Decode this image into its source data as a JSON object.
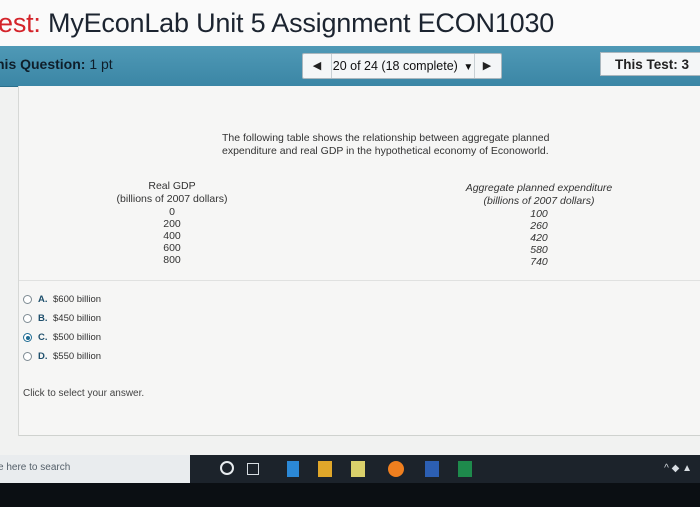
{
  "header": {
    "title_accent": "est:",
    "title_rest": " MyEconLab Unit 5 Assignment ECON1030"
  },
  "question_bar": {
    "points_label": "nis Question:",
    "points_value": " 1 pt",
    "prev_icon": "triangle-left-icon",
    "next_icon": "triangle-right-icon",
    "progress": "20 of 24 (18 complete)",
    "this_test": "This Test: 3"
  },
  "question": {
    "intro": "The following table shows the relationship between aggregate planned expenditure and real GDP in the hypothetical economy of Econoworld.",
    "table": {
      "left_header_1": "Real GDP",
      "left_header_2": "(billions of 2007 dollars)",
      "right_header_1": "Aggregate planned expenditure",
      "right_header_2": "(billions of 2007 dollars)",
      "real_gdp": [
        "0",
        "200",
        "400",
        "600",
        "800"
      ],
      "planned_expenditure": [
        "100",
        "260",
        "420",
        "580",
        "740"
      ]
    },
    "options": [
      {
        "letter": "A.",
        "text": "$600 billion"
      },
      {
        "letter": "B.",
        "text": "$450 billion"
      },
      {
        "letter": "C.",
        "text": "$500 billion"
      },
      {
        "letter": "D.",
        "text": "$550 billion"
      }
    ],
    "selected_option": "C.",
    "hint": "Click to select your answer."
  },
  "taskbar": {
    "search_placeholder": "e here to search",
    "tray": "^ ◆ ▲"
  }
}
